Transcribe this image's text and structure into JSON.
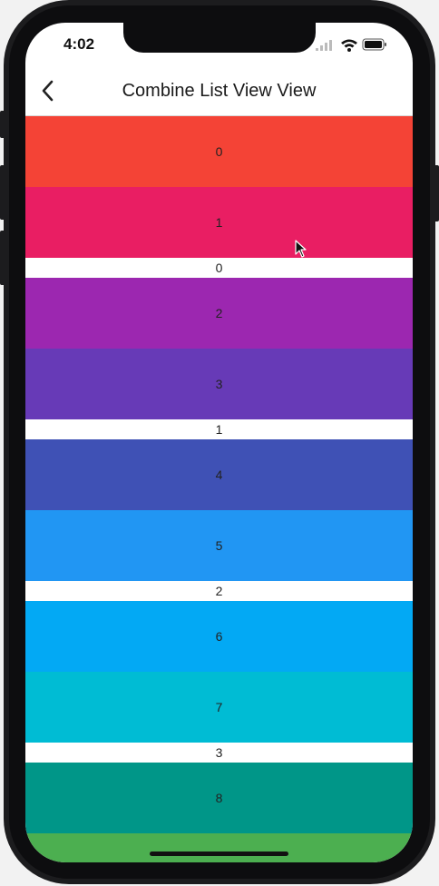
{
  "status": {
    "time": "4:02"
  },
  "nav": {
    "title": "Combine List View View"
  },
  "list": {
    "items": [
      {
        "label": "0",
        "color": "#f44336"
      },
      {
        "label": "1",
        "color": "#e91e63"
      },
      {
        "label": "0",
        "color": "#ffffff",
        "type": "header"
      },
      {
        "label": "2",
        "color": "#9c27b0"
      },
      {
        "label": "3",
        "color": "#673ab7"
      },
      {
        "label": "1",
        "color": "#ffffff",
        "type": "header"
      },
      {
        "label": "4",
        "color": "#3f51b5"
      },
      {
        "label": "5",
        "color": "#2196f3"
      },
      {
        "label": "2",
        "color": "#ffffff",
        "type": "header"
      },
      {
        "label": "6",
        "color": "#03a9f4"
      },
      {
        "label": "7",
        "color": "#00bcd4"
      },
      {
        "label": "3",
        "color": "#ffffff",
        "type": "header"
      },
      {
        "label": "8",
        "color": "#009688"
      },
      {
        "label": "",
        "color": "#4caf50"
      }
    ]
  }
}
